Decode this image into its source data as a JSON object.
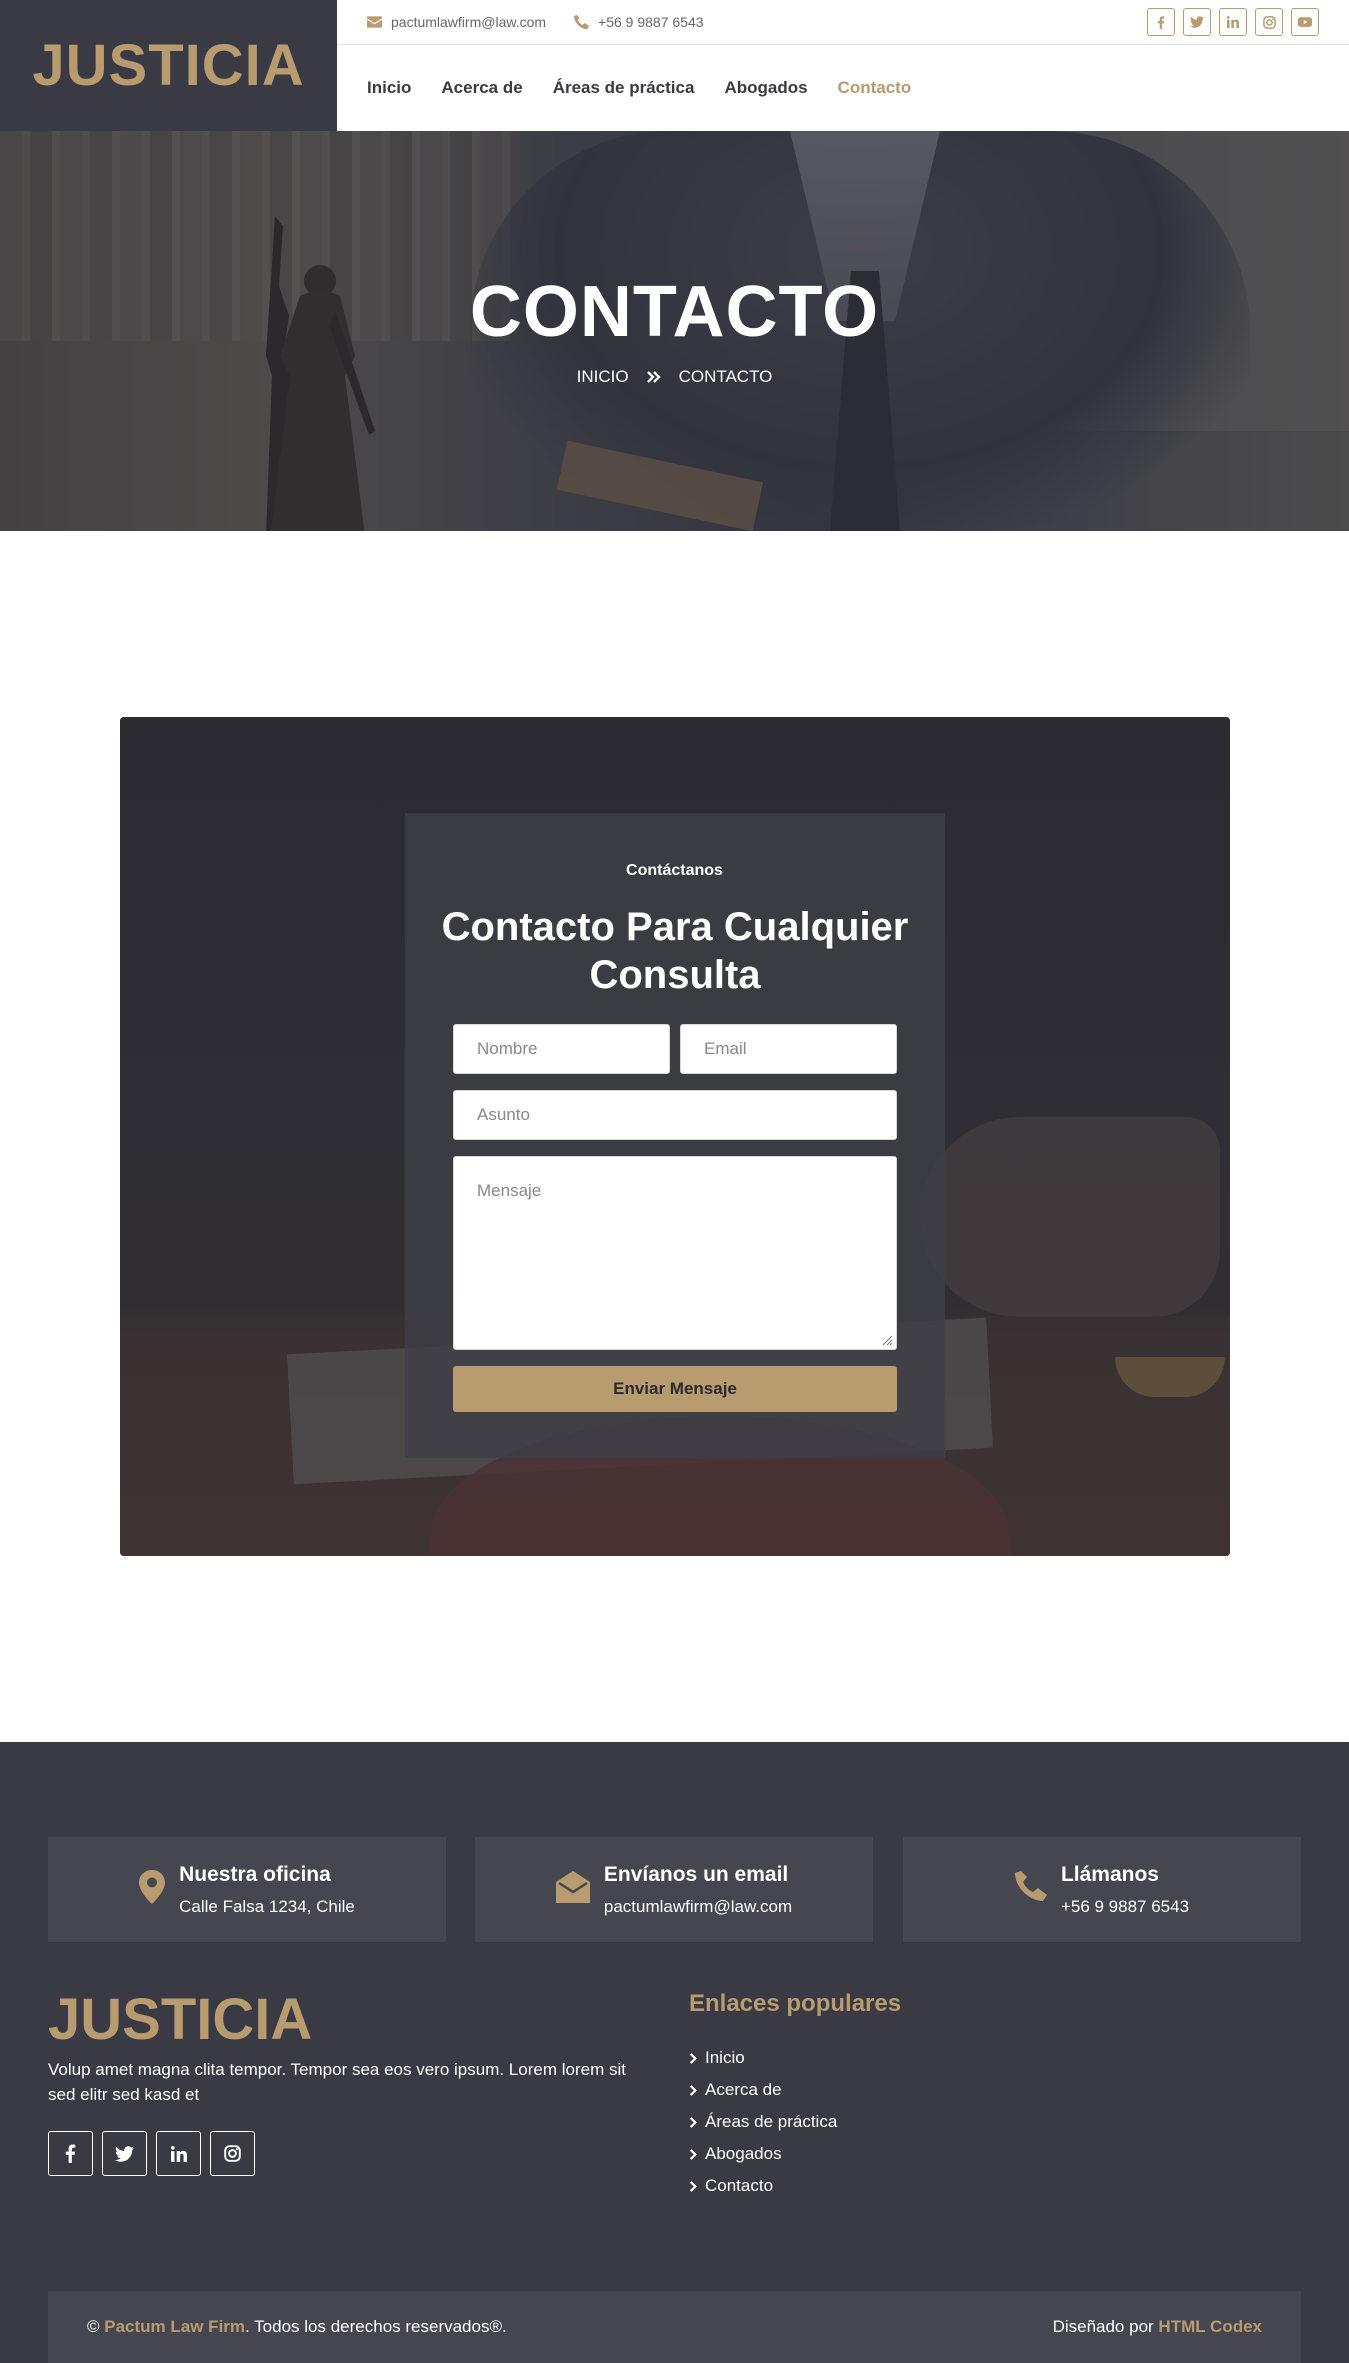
{
  "brand": {
    "logo": "JUSTICIA"
  },
  "topbar": {
    "email": "pactumlawfirm@law.com",
    "phone": "+56 9 9887 6543",
    "socials": [
      "facebook-icon",
      "twitter-icon",
      "linkedin-icon",
      "instagram-icon",
      "youtube-icon"
    ]
  },
  "nav": {
    "items": [
      {
        "label": "Inicio"
      },
      {
        "label": "Acerca de"
      },
      {
        "label": "Áreas de práctica"
      },
      {
        "label": "Abogados"
      },
      {
        "label": "Contacto"
      }
    ],
    "active": "Contacto"
  },
  "hero": {
    "title": "CONTACTO",
    "breadcrumb": [
      "INICIO",
      "CONTACTO"
    ]
  },
  "contact": {
    "kicker": "Contáctanos",
    "title": "Contacto Para Cualquier Consulta",
    "name_placeholder": "Nombre",
    "email_placeholder": "Email",
    "subject_placeholder": "Asunto",
    "message_placeholder": "Mensaje",
    "submit_label": "Enviar Mensaje"
  },
  "footer": {
    "info": [
      {
        "title": "Nuestra oficina",
        "text": "Calle Falsa 1234, Chile",
        "icon": "map-pin-icon"
      },
      {
        "title": "Envíanos un email",
        "text": "pactumlawfirm@law.com",
        "icon": "envelope-open-icon"
      },
      {
        "title": "Llámanos",
        "text": "+56 9 9887 6543",
        "icon": "phone-icon"
      }
    ],
    "logo": "JUSTICIA",
    "description": "Volup amet magna clita tempor. Tempor sea eos vero ipsum. Lorem lorem sit sed elitr sed kasd et",
    "socials": [
      "facebook-icon",
      "twitter-icon",
      "linkedin-icon",
      "instagram-icon"
    ],
    "links_title": "Enlaces populares",
    "links": [
      "Inicio",
      "Acerca de",
      "Áreas de práctica",
      "Abogados",
      "Contacto"
    ],
    "copyright_symbol": "©",
    "copyright_brand": "Pactum Law Firm",
    "copyright_text": ". Todos los derechos reservados®.",
    "designed_by": "Diseñado por",
    "designer": "HTML Codex"
  },
  "colors": {
    "accent": "#b89b6e",
    "dark": "#3a3a44",
    "panel": "#464650"
  }
}
